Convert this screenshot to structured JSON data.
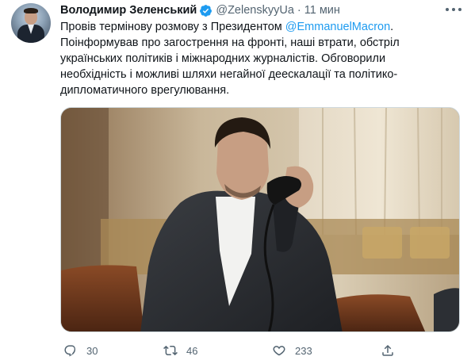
{
  "author": {
    "name": "Володимир Зеленський",
    "handle": "@ZelenskyyUa",
    "separator": "·",
    "time": "11 мин",
    "verified": true
  },
  "tweet": {
    "line1_before": "Провів термінову розмову з Президентом ",
    "line1_mention": "@EmmanuelMacron",
    "line1_after": ".",
    "line2": "Поінформував про загострення на фронті, наші втрати, обстріл",
    "line3": "українських політиків і міжнародних журналістів. Обговорили",
    "line4": "необхідність і можливі шляхи негайної деескалації та політико-",
    "line5": "дипломатичного врегулювання."
  },
  "actions": {
    "reply_count": "30",
    "retweet_count": "46",
    "like_count": "233"
  },
  "colors": {
    "accent": "#1d9bf0",
    "muted": "#536471",
    "text": "#0f1419"
  },
  "icons": {
    "avatar": "profile-avatar",
    "verified": "verified-badge-icon",
    "more": "more-options-icon",
    "reply": "reply-icon",
    "retweet": "retweet-icon",
    "like": "heart-icon",
    "share": "share-icon"
  }
}
